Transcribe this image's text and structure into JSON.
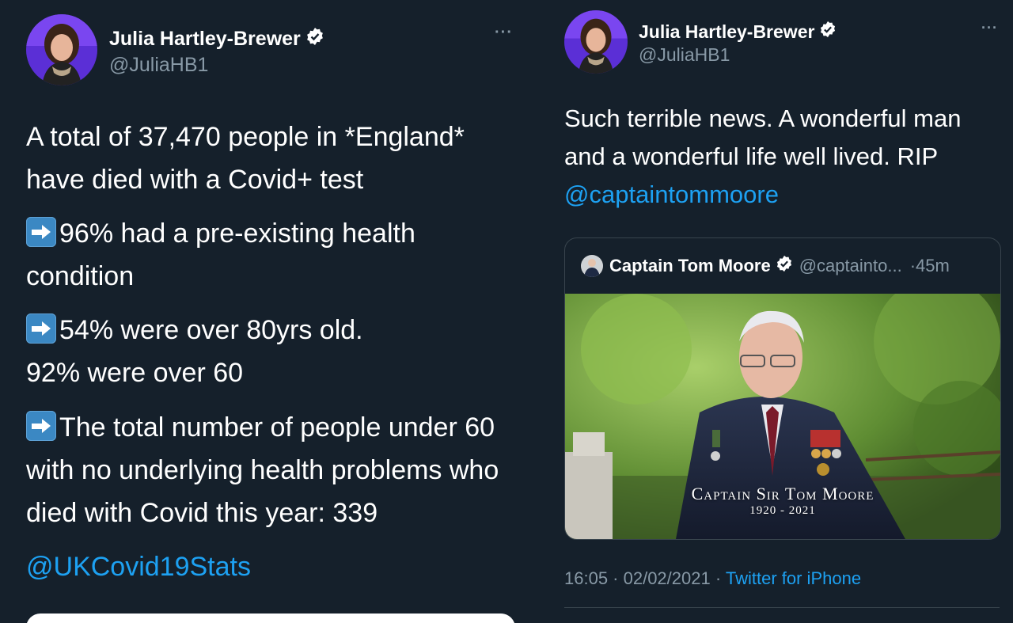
{
  "left_tweet": {
    "author_name": "Julia Hartley-Brewer",
    "handle": "@JuliaHB1",
    "more_icon": "more-icon",
    "paragraph1": "A total of 37,470 people in *England* have died with a Covid+ test",
    "bullet1": "96% had a pre-existing health condition",
    "bullet2_line1": "54% were over 80yrs old.",
    "bullet2_line2": "92% were over 60",
    "bullet3": "The total number of people under 60 with no underlying health problems who died with Covid this year: 339",
    "mention": "@UKCovid19Stats"
  },
  "right_tweet": {
    "author_name": "Julia Hartley-Brewer",
    "handle": "@JuliaHB1",
    "text": "Such terrible news. A wonderful man and a wonderful life well lived. RIP",
    "mention": "@captaintommoore",
    "quoted": {
      "name": "Captain Tom Moore",
      "handle": "@captainto...",
      "time": "·45m",
      "photo_caption_title": "Captain Sir Tom Moore",
      "photo_caption_years": "1920 - 2021"
    },
    "timestamp": "16:05 · 02/02/2021 ·",
    "source": "Twitter for iPhone"
  },
  "colors": {
    "background": "#15202b",
    "link": "#1da1f2",
    "muted": "#8899a6",
    "verified": "#ffffff"
  }
}
